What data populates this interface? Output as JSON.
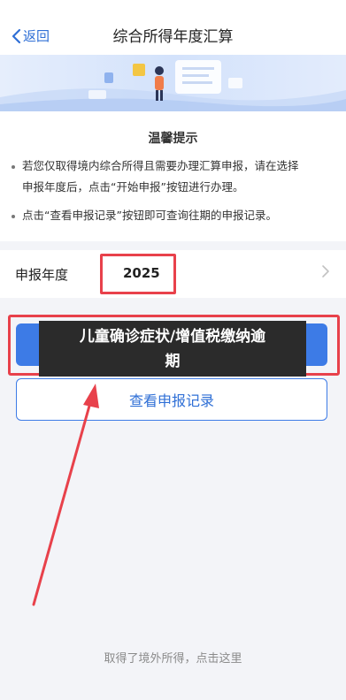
{
  "nav": {
    "back_label": "返回",
    "title": "综合所得年度汇算"
  },
  "banner": {
    "illustration": "tax-office-illustration"
  },
  "tips": {
    "title": "温馨提示",
    "items": [
      {
        "line1": "若您仅取得境内综合所得且需要办理汇算申报，请在选择",
        "line2": "申报年度后，点击“开始申报”按钮进行办理。"
      },
      {
        "line1": "点击“查看申报记录”按钮即可查询往期的申报记录。"
      }
    ]
  },
  "year": {
    "label": "申报年度",
    "value": "2025"
  },
  "overlay": {
    "line1": "儿童确诊症状/增值税缴纳逾",
    "line2": "期"
  },
  "record_button": {
    "label": "查看申报记录"
  },
  "foreign_link": {
    "label": "取得了境外所得，点击这里"
  },
  "colors": {
    "accent": "#3d7be6",
    "annotation_red": "#e8414b"
  }
}
